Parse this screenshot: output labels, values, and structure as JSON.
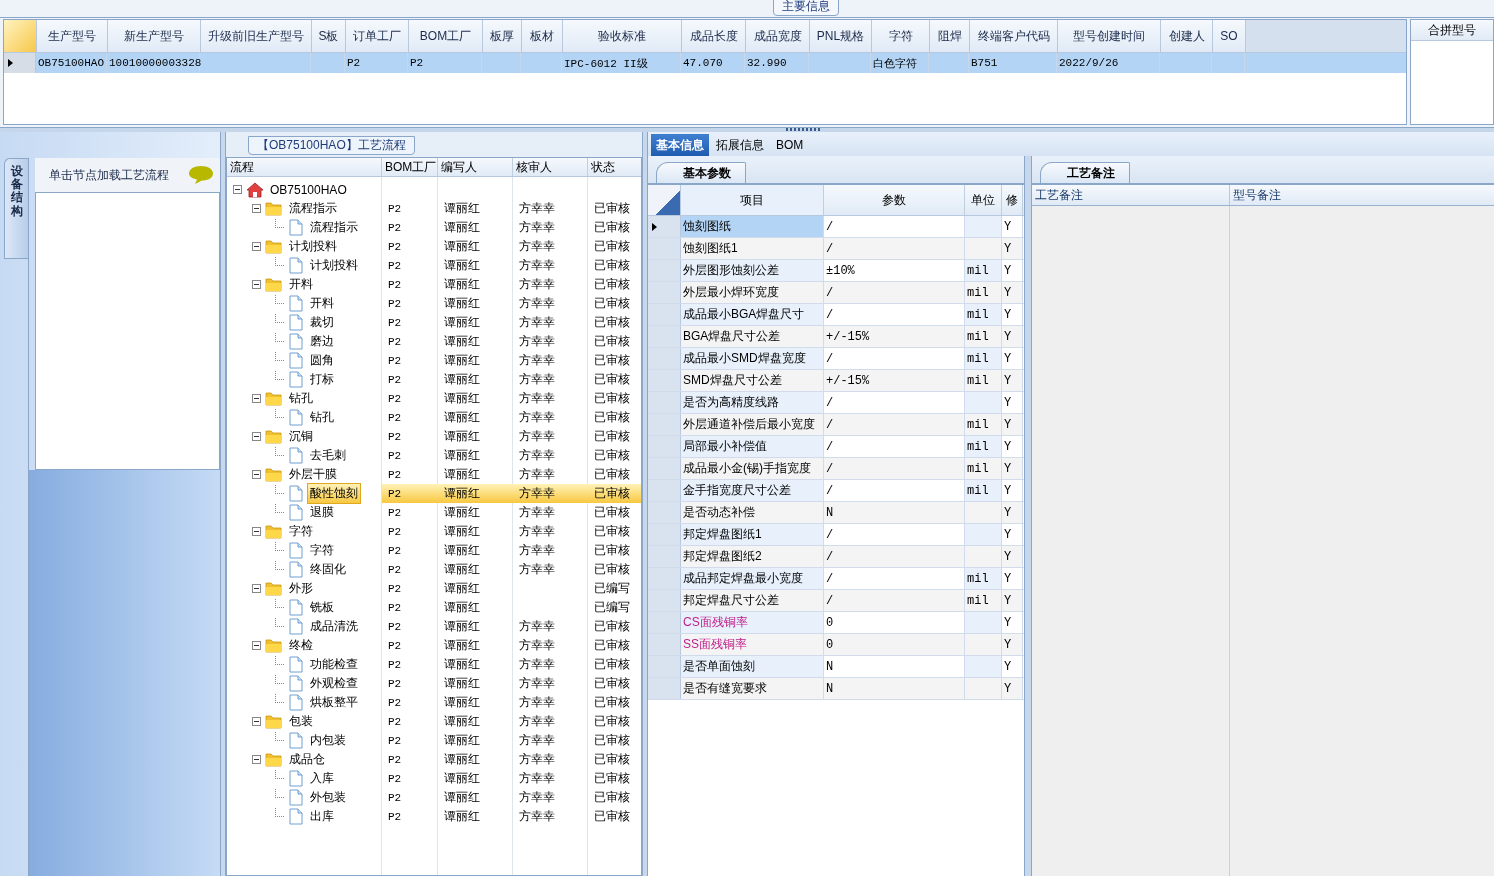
{
  "main_info": {
    "title": "主要信息",
    "columns": [
      "生产型号",
      "新生产型号",
      "升级前旧生产型号",
      "S板",
      "订单工厂",
      "BOM工厂",
      "板厚",
      "板材",
      "验收标准",
      "成品长度",
      "成品宽度",
      "PNL规格",
      "字符",
      "阻焊",
      "终端客户代码",
      "型号创建时间",
      "创建人",
      "SO"
    ],
    "rows": [
      {
        "selected": true,
        "cells": [
          "OB75100HAO",
          "10010000003328",
          "",
          "",
          "P2",
          "P2",
          "",
          "",
          "IPC-6012 II级",
          "47.070",
          "32.990",
          "",
          "白色字符",
          "",
          "B751",
          "2022/9/26",
          "",
          ""
        ]
      }
    ],
    "side_title": "合拼型号"
  },
  "equipment": {
    "tab": "设备结构",
    "hint": "单击节点加载工艺流程"
  },
  "process_tree": {
    "title": "【OB75100HAO】工艺流程",
    "columns": [
      "流程",
      "BOM工厂",
      "编写人",
      "核审人",
      "状态"
    ],
    "root": {
      "label": "OB75100HAO",
      "kind": "root",
      "expanded": true,
      "selected": false,
      "children": [
        {
          "label": "流程指示",
          "kind": "folder",
          "expanded": true,
          "selected": false,
          "bom": "P2",
          "writer": "谭丽红",
          "reviewer": "方幸幸",
          "status": "已审核",
          "children": [
            {
              "label": "流程指示",
              "kind": "file",
              "selected": false,
              "bom": "P2",
              "writer": "谭丽红",
              "reviewer": "方幸幸",
              "status": "已审核"
            }
          ]
        },
        {
          "label": "计划投料",
          "kind": "folder",
          "expanded": true,
          "selected": false,
          "bom": "P2",
          "writer": "谭丽红",
          "reviewer": "方幸幸",
          "status": "已审核",
          "children": [
            {
              "label": "计划投料",
              "kind": "file",
              "selected": false,
              "bom": "P2",
              "writer": "谭丽红",
              "reviewer": "方幸幸",
              "status": "已审核"
            }
          ]
        },
        {
          "label": "开料",
          "kind": "folder",
          "expanded": true,
          "selected": false,
          "bom": "P2",
          "writer": "谭丽红",
          "reviewer": "方幸幸",
          "status": "已审核",
          "children": [
            {
              "label": "开料",
              "kind": "file",
              "selected": false,
              "bom": "P2",
              "writer": "谭丽红",
              "reviewer": "方幸幸",
              "status": "已审核"
            },
            {
              "label": "裁切",
              "kind": "file",
              "selected": false,
              "bom": "P2",
              "writer": "谭丽红",
              "reviewer": "方幸幸",
              "status": "已审核"
            },
            {
              "label": "磨边",
              "kind": "file",
              "selected": false,
              "bom": "P2",
              "writer": "谭丽红",
              "reviewer": "方幸幸",
              "status": "已审核"
            },
            {
              "label": "圆角",
              "kind": "file",
              "selected": false,
              "bom": "P2",
              "writer": "谭丽红",
              "reviewer": "方幸幸",
              "status": "已审核"
            },
            {
              "label": "打标",
              "kind": "file",
              "selected": false,
              "bom": "P2",
              "writer": "谭丽红",
              "reviewer": "方幸幸",
              "status": "已审核"
            }
          ]
        },
        {
          "label": "钻孔",
          "kind": "folder",
          "expanded": true,
          "selected": false,
          "bom": "P2",
          "writer": "谭丽红",
          "reviewer": "方幸幸",
          "status": "已审核",
          "children": [
            {
              "label": "钻孔",
              "kind": "file",
              "selected": false,
              "bom": "P2",
              "writer": "谭丽红",
              "reviewer": "方幸幸",
              "status": "已审核"
            }
          ]
        },
        {
          "label": "沉铜",
          "kind": "folder",
          "expanded": true,
          "selected": false,
          "bom": "P2",
          "writer": "谭丽红",
          "reviewer": "方幸幸",
          "status": "已审核",
          "children": [
            {
              "label": "去毛刺",
              "kind": "file",
              "selected": false,
              "bom": "P2",
              "writer": "谭丽红",
              "reviewer": "方幸幸",
              "status": "已审核"
            }
          ]
        },
        {
          "label": "外层干膜",
          "kind": "folder",
          "expanded": true,
          "selected": false,
          "bom": "P2",
          "writer": "谭丽红",
          "reviewer": "方幸幸",
          "status": "已审核",
          "children": [
            {
              "label": "酸性蚀刻",
              "kind": "file",
              "selected": true,
              "bom": "P2",
              "writer": "谭丽红",
              "reviewer": "方幸幸",
              "status": "已审核"
            },
            {
              "label": "退膜",
              "kind": "file",
              "selected": false,
              "bom": "P2",
              "writer": "谭丽红",
              "reviewer": "方幸幸",
              "status": "已审核"
            }
          ]
        },
        {
          "label": "字符",
          "kind": "folder",
          "expanded": true,
          "selected": false,
          "bom": "P2",
          "writer": "谭丽红",
          "reviewer": "方幸幸",
          "status": "已审核",
          "children": [
            {
              "label": "字符",
              "kind": "file",
              "selected": false,
              "bom": "P2",
              "writer": "谭丽红",
              "reviewer": "方幸幸",
              "status": "已审核"
            },
            {
              "label": "终固化",
              "kind": "file",
              "selected": false,
              "bom": "P2",
              "writer": "谭丽红",
              "reviewer": "方幸幸",
              "status": "已审核"
            }
          ]
        },
        {
          "label": "外形",
          "kind": "folder",
          "expanded": true,
          "selected": false,
          "bom": "P2",
          "writer": "谭丽红",
          "status": "已编写",
          "children": [
            {
              "label": "铣板",
              "kind": "file",
              "selected": false,
              "bom": "P2",
              "writer": "谭丽红",
              "status": "已编写"
            },
            {
              "label": "成品清洗",
              "kind": "file",
              "selected": false,
              "bom": "P2",
              "writer": "谭丽红",
              "reviewer": "方幸幸",
              "status": "已审核"
            }
          ]
        },
        {
          "label": "终检",
          "kind": "folder",
          "expanded": true,
          "selected": false,
          "bom": "P2",
          "writer": "谭丽红",
          "reviewer": "方幸幸",
          "status": "已审核",
          "children": [
            {
              "label": "功能检查",
              "kind": "file",
              "selected": false,
              "bom": "P2",
              "writer": "谭丽红",
              "reviewer": "方幸幸",
              "status": "已审核"
            },
            {
              "label": "外观检查",
              "kind": "file",
              "selected": false,
              "bom": "P2",
              "writer": "谭丽红",
              "reviewer": "方幸幸",
              "status": "已审核"
            },
            {
              "label": "烘板整平",
              "kind": "file",
              "selected": false,
              "bom": "P2",
              "writer": "谭丽红",
              "reviewer": "方幸幸",
              "status": "已审核"
            }
          ]
        },
        {
          "label": "包装",
          "kind": "folder",
          "expanded": true,
          "selected": false,
          "bom": "P2",
          "writer": "谭丽红",
          "reviewer": "方幸幸",
          "status": "已审核",
          "children": [
            {
              "label": "内包装",
              "kind": "file",
              "selected": false,
              "bom": "P2",
              "writer": "谭丽红",
              "reviewer": "方幸幸",
              "status": "已审核"
            }
          ]
        },
        {
          "label": "成品仓",
          "kind": "folder",
          "expanded": true,
          "selected": false,
          "bom": "P2",
          "writer": "谭丽红",
          "reviewer": "方幸幸",
          "status": "已审核",
          "children": [
            {
              "label": "入库",
              "kind": "file",
              "selected": false,
              "bom": "P2",
              "writer": "谭丽红",
              "reviewer": "方幸幸",
              "status": "已审核"
            },
            {
              "label": "外包装",
              "kind": "file",
              "selected": false,
              "bom": "P2",
              "writer": "谭丽红",
              "reviewer": "方幸幸",
              "status": "已审核"
            },
            {
              "label": "出库",
              "kind": "file",
              "selected": false,
              "bom": "P2",
              "writer": "谭丽红",
              "reviewer": "方幸幸",
              "status": "已审核"
            }
          ]
        }
      ]
    }
  },
  "detail_tabs": [
    {
      "label": "基本信息",
      "selected": true
    },
    {
      "label": "拓展信息",
      "selected": false
    },
    {
      "label": "BOM",
      "selected": false
    }
  ],
  "basic_params": {
    "tab": "基本参数",
    "columns": [
      "项目",
      "参数",
      "单位",
      "修"
    ],
    "rows": [
      {
        "item": "蚀刻图纸",
        "value": "/",
        "flag": "Y",
        "selected": true,
        "kind": "plain"
      },
      {
        "item": "蚀刻图纸1",
        "value": "/",
        "flag": "Y",
        "selected": false,
        "kind": "plain"
      },
      {
        "item": "外层图形蚀刻公差",
        "value": "±10%",
        "unit": "mil",
        "flag": "Y",
        "selected": false,
        "kind": "plain"
      },
      {
        "item": "外层最小焊环宽度",
        "value": "/",
        "unit": "mil",
        "flag": "Y",
        "selected": false,
        "kind": "plain"
      },
      {
        "item": "成品最小BGA焊盘尺寸",
        "value": "/",
        "unit": "mil",
        "flag": "Y",
        "selected": false,
        "kind": "plain"
      },
      {
        "item": "BGA焊盘尺寸公差",
        "value": "+/-15%",
        "unit": "mil",
        "flag": "Y",
        "selected": false,
        "kind": "plain"
      },
      {
        "item": "成品最小SMD焊盘宽度",
        "value": "/",
        "unit": "mil",
        "flag": "Y",
        "selected": false,
        "kind": "plain"
      },
      {
        "item": "SMD焊盘尺寸公差",
        "value": "+/-15%",
        "unit": "mil",
        "flag": "Y",
        "selected": false,
        "kind": "plain"
      },
      {
        "item": "是否为高精度线路",
        "value": "/",
        "flag": "Y",
        "selected": false,
        "kind": "plain"
      },
      {
        "item": "外层通道补偿后最小宽度",
        "value": "/",
        "unit": "mil",
        "flag": "Y",
        "selected": false,
        "kind": "plain"
      },
      {
        "item": "局部最小补偿值",
        "value": "/",
        "unit": "mil",
        "flag": "Y",
        "selected": false,
        "kind": "plain"
      },
      {
        "item": "成品最小金(锡)手指宽度",
        "value": "/",
        "unit": "mil",
        "flag": "Y",
        "selected": false,
        "kind": "plain"
      },
      {
        "item": "金手指宽度尺寸公差",
        "value": "/",
        "unit": "mil",
        "flag": "Y",
        "selected": false,
        "kind": "plain"
      },
      {
        "item": "是否动态补偿",
        "value": "N",
        "flag": "Y",
        "selected": false,
        "kind": "plain"
      },
      {
        "item": "邦定焊盘图纸1",
        "value": "/",
        "flag": "Y",
        "selected": false,
        "kind": "plain"
      },
      {
        "item": "邦定焊盘图纸2",
        "value": "/",
        "flag": "Y",
        "selected": false,
        "kind": "plain"
      },
      {
        "item": "成品邦定焊盘最小宽度",
        "value": "/",
        "unit": "mil",
        "flag": "Y",
        "selected": false,
        "kind": "plain"
      },
      {
        "item": "邦定焊盘尺寸公差",
        "value": "/",
        "unit": "mil",
        "flag": "Y",
        "selected": false,
        "kind": "plain"
      },
      {
        "item": "CS面残铜率",
        "value": "0",
        "flag": "Y",
        "selected": false,
        "kind": "copper"
      },
      {
        "item": "SS面残铜率",
        "value": "0",
        "flag": "Y",
        "selected": false,
        "kind": "copper"
      },
      {
        "item": "是否单面蚀刻",
        "value": "N",
        "flag": "Y",
        "selected": false,
        "kind": "plain"
      },
      {
        "item": "是否有缝宽要求",
        "value": "N",
        "flag": "Y",
        "selected": false,
        "kind": "plain"
      }
    ]
  },
  "notes": {
    "tab": "工艺备注",
    "columns": [
      "工艺备注",
      "型号备注"
    ]
  }
}
